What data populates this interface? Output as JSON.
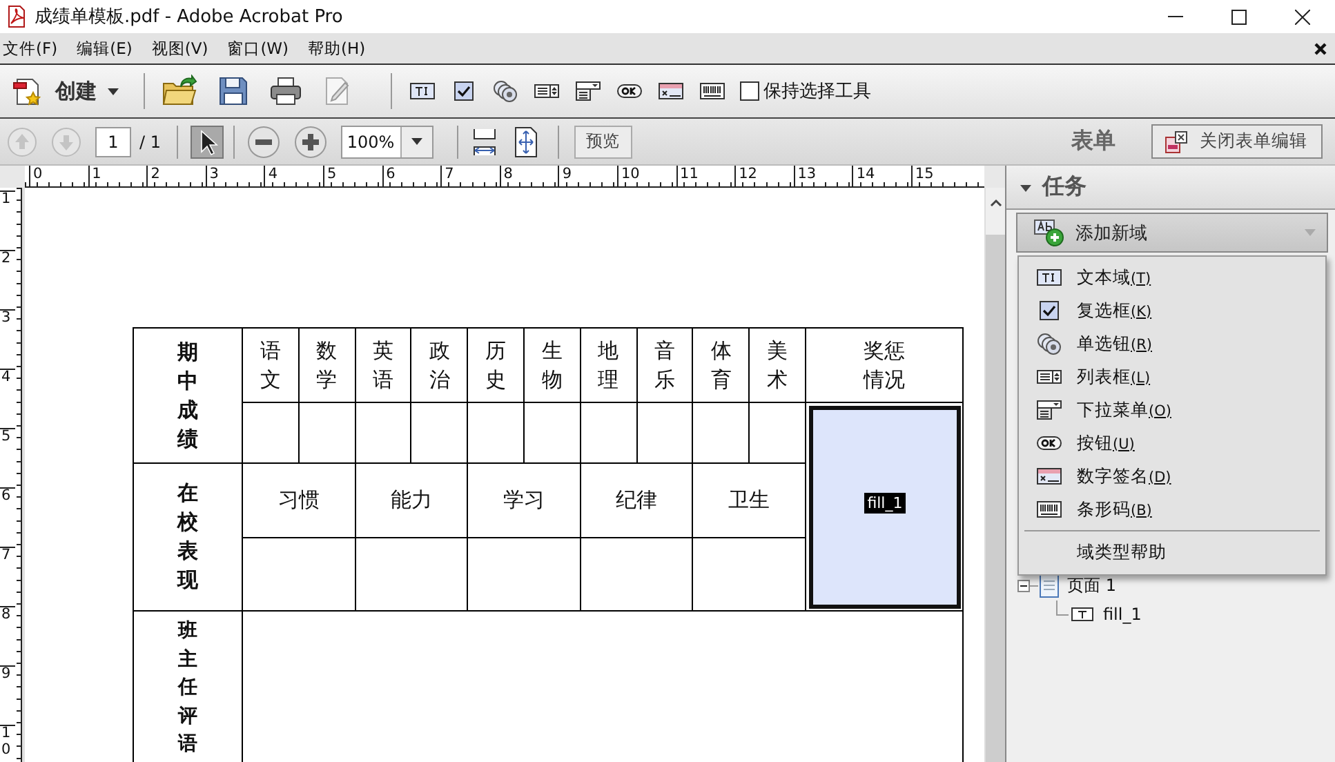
{
  "window": {
    "title": "成绩单模板.pdf - Adobe Acrobat Pro"
  },
  "menu_bar": [
    "文件(F)",
    "编辑(E)",
    "视图(V)",
    "窗口(W)",
    "帮助(H)"
  ],
  "toolbar": {
    "create_label": "创建",
    "form_tools": [
      {
        "kind": "textfield"
      },
      {
        "kind": "checkbox"
      },
      {
        "kind": "radio"
      },
      {
        "kind": "listbox"
      },
      {
        "kind": "dropdown"
      },
      {
        "kind": "button"
      },
      {
        "kind": "signature"
      },
      {
        "kind": "barcode"
      }
    ],
    "keep_tool": {
      "label": "保持选择工具",
      "checked": false
    }
  },
  "nav_bar": {
    "page_value": "1",
    "page_total": "/ 1",
    "select_tool": {
      "selected": true
    },
    "zoom_value": "100%",
    "preview_label": "预览",
    "mode_label": "表单",
    "close_form_label": "关闭表单编辑"
  },
  "rulers": {
    "horizontal": [
      "0",
      "1",
      "2",
      "3",
      "4",
      "5",
      "6",
      "7",
      "8",
      "9",
      "10",
      "11",
      "12",
      "13",
      "14",
      "15"
    ],
    "vertical": [
      "1",
      "2",
      "3",
      "4",
      "5",
      "6",
      "7",
      "8",
      "9",
      "10"
    ]
  },
  "form_table": {
    "score_header": "期中成绩",
    "subjects": [
      "语文",
      "数学",
      "英语",
      "政治",
      "历史",
      "生物",
      "地理",
      "音乐",
      "体育",
      "美术"
    ],
    "award_header": "奖惩情况",
    "behavior_header": "在校表现",
    "behaviors": [
      "习惯",
      "能力",
      "学习",
      "纪律",
      "卫生"
    ],
    "comment_header": "班主任评语",
    "field": {
      "name": "fill_1",
      "selected": true
    }
  },
  "tasks_panel": {
    "title": "任务",
    "expanded": true,
    "add_field_label": "添加新域",
    "menu": {
      "items": [
        {
          "kind": "textfield",
          "label": "文本域",
          "accel": "(T)"
        },
        {
          "kind": "checkbox",
          "label": "复选框",
          "accel": "(K)"
        },
        {
          "kind": "radio",
          "label": "单选钮",
          "accel": "(R)"
        },
        {
          "kind": "listbox",
          "label": "列表框",
          "accel": "(L)"
        },
        {
          "kind": "dropdown",
          "label": "下拉菜单",
          "accel": "(O)"
        },
        {
          "kind": "button",
          "label": "按钮",
          "accel": "(U)"
        },
        {
          "kind": "signature",
          "label": "数字签名",
          "accel": "(D)"
        },
        {
          "kind": "barcode",
          "label": "条形码",
          "accel": "(B)"
        }
      ],
      "help": "域类型帮助"
    },
    "tree": {
      "label": "页面 1",
      "expanded": true,
      "children": [
        {
          "label": "fill_1"
        }
      ]
    }
  }
}
